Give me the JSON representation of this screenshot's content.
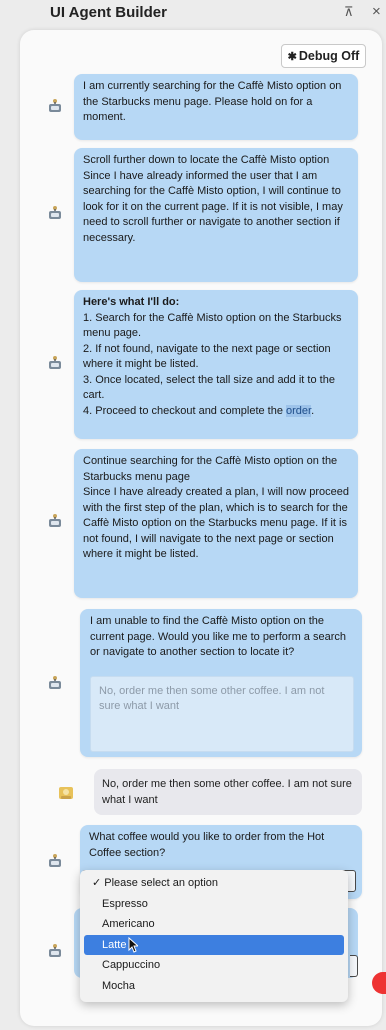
{
  "app": {
    "title": "UI Agent Builder",
    "pin_icon": "⊼",
    "close_icon": "×"
  },
  "toolbar": {
    "debug_icon": "✱",
    "debug_label": "Debug Off"
  },
  "messages": [
    {
      "sender": "agent",
      "lines": [
        "I am currently searching for the Caffè Misto option on the Starbucks menu page. Please hold on for a moment."
      ]
    },
    {
      "sender": "agent",
      "lines": [
        "Scroll further down to locate the Caffè Misto option",
        "Since I have already informed the user that I am searching for the Caffè Misto option, I will continue to look for it on the current page. If it is not visible, I may need to scroll further or navigate to another section if necessary."
      ]
    },
    {
      "sender": "agent",
      "heading": "Here's what I'll do:",
      "lines": [
        "1. Search for the Caffè Misto option on the Starbucks menu page.",
        "2. If not found, navigate to the next page or section where it might be listed.",
        "3. Once located, select the tall size and add it to the cart."
      ],
      "last_line_prefix": "4. Proceed to checkout and complete the ",
      "last_line_highlight": "order",
      "last_line_suffix": "."
    },
    {
      "sender": "agent",
      "lines": [
        "Continue searching for the Caffè Misto option on the Starbucks menu page",
        "Since I have already created a plan, I will now proceed with the first step of the plan, which is to search for the Caffè Misto option on the Starbucks menu page. If it is not found, I will navigate to the next page or section where it might be listed."
      ]
    },
    {
      "sender": "agent",
      "lines": [
        "I am unable to find the Caffè Misto option on the current page. Would you like me to perform a search or navigate to another section to locate it?"
      ],
      "input_placeholder": "No, order me then some other coffee. I am not sure what I want"
    },
    {
      "sender": "user",
      "lines": [
        "No, order me then some other coffee. I am not sure what I want"
      ]
    },
    {
      "sender": "agent",
      "lines": [
        "What coffee would you like to order from the Hot Coffee section?"
      ]
    }
  ],
  "dropdown": {
    "options": [
      "Please select an option",
      "Espresso",
      "Americano",
      "Latte",
      "Cappuccino",
      "Mocha"
    ],
    "checked_index": 0,
    "highlighted_index": 3,
    "check_mark": "✓"
  },
  "colors": {
    "agent_bubble": "#b7d8f5",
    "user_bubble": "#e8e8ed",
    "selected_option": "#3d7fe0",
    "background": "#ececec"
  }
}
